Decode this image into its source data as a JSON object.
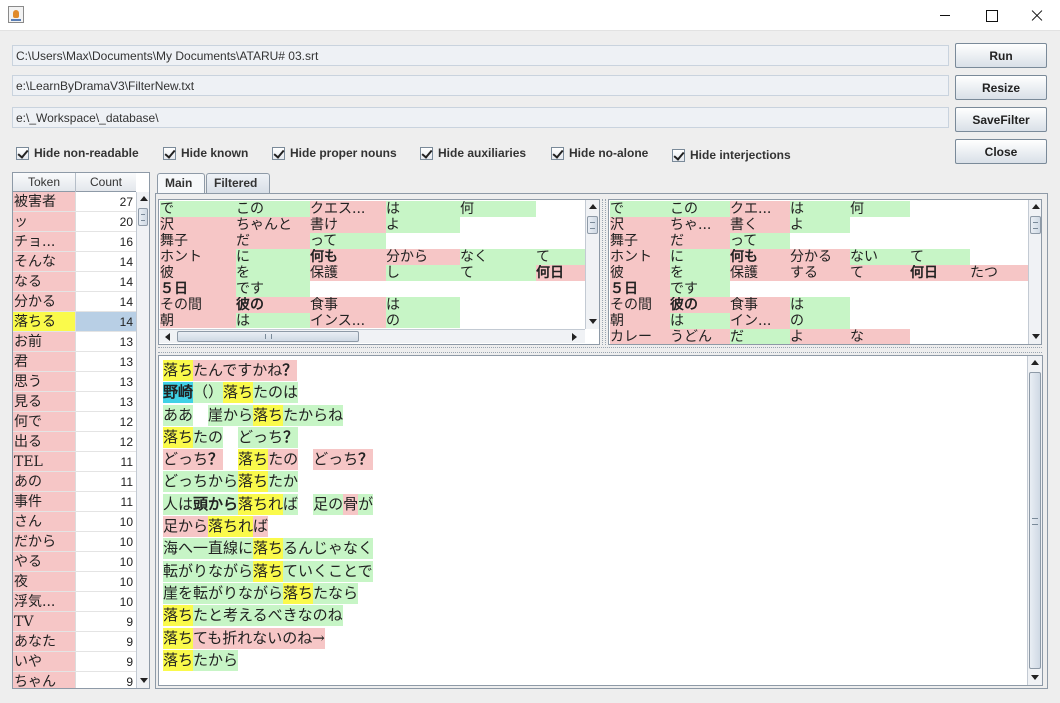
{
  "window": {
    "icon": "java-cup-icon",
    "controls": [
      "minimize-icon",
      "maximize-icon",
      "close-icon"
    ]
  },
  "paths": {
    "subtitle_file": "C:\\Users\\Max\\Documents\\My Documents\\ATARU# 03.srt",
    "filter_file": "e:\\LearnByDramaV3\\FilterNew.txt",
    "database_dir": "e:\\_Workspace\\_database\\"
  },
  "buttons": {
    "run": "Run",
    "resize": "Resize",
    "save_filter": "SaveFilter",
    "close": "Close"
  },
  "filters": [
    {
      "label": "Hide non-readable",
      "checked": true
    },
    {
      "label": "Hide known",
      "checked": true
    },
    {
      "label": "Hide proper nouns",
      "checked": true
    },
    {
      "label": "Hide auxiliaries",
      "checked": true
    },
    {
      "label": "Hide no-alone",
      "checked": true
    },
    {
      "label": "Hide interjections",
      "checked": true
    }
  ],
  "token_table": {
    "headers": [
      "Token",
      "Count"
    ],
    "selected_index": 6,
    "rows": [
      {
        "token": "被害者",
        "count": "27"
      },
      {
        "token": "ッ",
        "count": "20"
      },
      {
        "token": "チョ...",
        "count": "16"
      },
      {
        "token": "そんな",
        "count": "14"
      },
      {
        "token": "なる",
        "count": "14"
      },
      {
        "token": "分かる",
        "count": "14"
      },
      {
        "token": "落ちる",
        "count": "14"
      },
      {
        "token": "お前",
        "count": "13"
      },
      {
        "token": "君",
        "count": "13"
      },
      {
        "token": "思う",
        "count": "13"
      },
      {
        "token": "見る",
        "count": "13"
      },
      {
        "token": "何で",
        "count": "12"
      },
      {
        "token": "出る",
        "count": "12"
      },
      {
        "token": "TEL",
        "count": "11"
      },
      {
        "token": "あの",
        "count": "11"
      },
      {
        "token": "事件",
        "count": "11"
      },
      {
        "token": "さん",
        "count": "10"
      },
      {
        "token": "だから",
        "count": "10"
      },
      {
        "token": "やる",
        "count": "10"
      },
      {
        "token": "夜",
        "count": "10"
      },
      {
        "token": "浮気...",
        "count": "10"
      },
      {
        "token": "TV",
        "count": "9"
      },
      {
        "token": "あなた",
        "count": "9"
      },
      {
        "token": "いや",
        "count": "9"
      },
      {
        "token": "ちゃん",
        "count": "9"
      }
    ]
  },
  "tabs": {
    "main": "Main",
    "filtered": "Filtered",
    "active": "main"
  },
  "colors": {
    "known": "#f6c6c6",
    "green": "#c7f5c6",
    "highlight": "#fafa4b",
    "name": "#3fd1e6",
    "selection": "#b8cfe5"
  },
  "grid_left": [
    [
      {
        "t": "で",
        "c": "g"
      },
      {
        "t": "この",
        "c": "g"
      },
      {
        "t": "クエス...",
        "c": "k"
      },
      {
        "t": "は",
        "c": "g"
      },
      {
        "t": "何",
        "c": "g"
      },
      {
        "t": "",
        "c": "e"
      }
    ],
    [
      {
        "t": "沢",
        "c": "k"
      },
      {
        "t": "ちゃんと",
        "c": "k"
      },
      {
        "t": "書け",
        "c": "k"
      },
      {
        "t": "よ",
        "c": "g"
      },
      {
        "t": "",
        "c": "e"
      },
      {
        "t": "",
        "c": "e"
      }
    ],
    [
      {
        "t": "舞子",
        "c": "k"
      },
      {
        "t": "だ",
        "c": "k"
      },
      {
        "t": "って",
        "c": "g"
      },
      {
        "t": "",
        "c": "e"
      },
      {
        "t": "",
        "c": "e"
      },
      {
        "t": "",
        "c": "e"
      }
    ],
    [
      {
        "t": "ホント",
        "c": "k"
      },
      {
        "t": "に",
        "c": "g"
      },
      {
        "t": "何も",
        "c": "k",
        "b": true
      },
      {
        "t": "分から",
        "c": "k"
      },
      {
        "t": "なく",
        "c": "g"
      },
      {
        "t": "て",
        "c": "g"
      }
    ],
    [
      {
        "t": "彼",
        "c": "k"
      },
      {
        "t": "を",
        "c": "g"
      },
      {
        "t": "保護",
        "c": "k"
      },
      {
        "t": "し",
        "c": "g"
      },
      {
        "t": "て",
        "c": "g"
      },
      {
        "t": "何日",
        "c": "k",
        "b": true
      }
    ],
    [
      {
        "t": "５日",
        "c": "k",
        "b": true
      },
      {
        "t": "です",
        "c": "g"
      },
      {
        "t": "",
        "c": "e"
      },
      {
        "t": "",
        "c": "e"
      },
      {
        "t": "",
        "c": "e"
      },
      {
        "t": "",
        "c": "e"
      }
    ],
    [
      {
        "t": "その間",
        "c": "k"
      },
      {
        "t": "彼の",
        "c": "k",
        "b": true
      },
      {
        "t": "食事",
        "c": "k"
      },
      {
        "t": "は",
        "c": "g"
      },
      {
        "t": "",
        "c": "e"
      },
      {
        "t": "",
        "c": "e"
      }
    ],
    [
      {
        "t": "朝",
        "c": "k"
      },
      {
        "t": "は",
        "c": "g"
      },
      {
        "t": "インス...",
        "c": "k"
      },
      {
        "t": "の",
        "c": "g"
      },
      {
        "t": "",
        "c": "e"
      },
      {
        "t": "",
        "c": "e"
      }
    ]
  ],
  "grid_right": [
    [
      {
        "t": "で",
        "c": "g"
      },
      {
        "t": "この",
        "c": "g"
      },
      {
        "t": "クエ...",
        "c": "k"
      },
      {
        "t": "は",
        "c": "g"
      },
      {
        "t": "何",
        "c": "g"
      },
      {
        "t": "",
        "c": "e"
      },
      {
        "t": "",
        "c": "e"
      }
    ],
    [
      {
        "t": "沢",
        "c": "k"
      },
      {
        "t": "ちゃ...",
        "c": "k"
      },
      {
        "t": "書く",
        "c": "k"
      },
      {
        "t": "よ",
        "c": "g"
      },
      {
        "t": "",
        "c": "e"
      },
      {
        "t": "",
        "c": "e"
      },
      {
        "t": "",
        "c": "e"
      }
    ],
    [
      {
        "t": "舞子",
        "c": "k"
      },
      {
        "t": "だ",
        "c": "k"
      },
      {
        "t": "って",
        "c": "g"
      },
      {
        "t": "",
        "c": "e"
      },
      {
        "t": "",
        "c": "e"
      },
      {
        "t": "",
        "c": "e"
      },
      {
        "t": "",
        "c": "e"
      }
    ],
    [
      {
        "t": "ホント",
        "c": "k"
      },
      {
        "t": "に",
        "c": "g"
      },
      {
        "t": "何も",
        "c": "k",
        "b": true
      },
      {
        "t": "分かる",
        "c": "k"
      },
      {
        "t": "ない",
        "c": "g"
      },
      {
        "t": "て",
        "c": "g"
      },
      {
        "t": "",
        "c": "e"
      }
    ],
    [
      {
        "t": "彼",
        "c": "k"
      },
      {
        "t": "を",
        "c": "g"
      },
      {
        "t": "保護",
        "c": "k"
      },
      {
        "t": "する",
        "c": "k"
      },
      {
        "t": "て",
        "c": "k"
      },
      {
        "t": "何日",
        "c": "k",
        "b": true
      },
      {
        "t": "たつ",
        "c": "k"
      }
    ],
    [
      {
        "t": "５日",
        "c": "k",
        "b": true
      },
      {
        "t": "です",
        "c": "g"
      },
      {
        "t": "",
        "c": "e"
      },
      {
        "t": "",
        "c": "e"
      },
      {
        "t": "",
        "c": "e"
      },
      {
        "t": "",
        "c": "e"
      },
      {
        "t": "",
        "c": "e"
      }
    ],
    [
      {
        "t": "その間",
        "c": "k"
      },
      {
        "t": "彼の",
        "c": "k",
        "b": true
      },
      {
        "t": "食事",
        "c": "k"
      },
      {
        "t": "は",
        "c": "g"
      },
      {
        "t": "",
        "c": "e"
      },
      {
        "t": "",
        "c": "e"
      },
      {
        "t": "",
        "c": "e"
      }
    ],
    [
      {
        "t": "朝",
        "c": "k"
      },
      {
        "t": "は",
        "c": "g"
      },
      {
        "t": "イン...",
        "c": "k"
      },
      {
        "t": "の",
        "c": "g"
      },
      {
        "t": "",
        "c": "e"
      },
      {
        "t": "",
        "c": "e"
      },
      {
        "t": "",
        "c": "e"
      }
    ],
    [
      {
        "t": "カレー",
        "c": "k"
      },
      {
        "t": "うどん",
        "c": "k"
      },
      {
        "t": "だ",
        "c": "g"
      },
      {
        "t": "よ",
        "c": "k"
      },
      {
        "t": "な",
        "c": "k"
      },
      {
        "t": "",
        "c": "e"
      },
      {
        "t": "",
        "c": "e"
      }
    ]
  ],
  "sentences": [
    [
      {
        "t": "落ち",
        "c": "y"
      },
      {
        "t": "たんですかね",
        "c": "k"
      },
      {
        "t": "？",
        "c": "k",
        "b": true
      }
    ],
    [
      {
        "t": "野崎",
        "c": "c",
        "b": true
      },
      {
        "t": "（）",
        "c": "g"
      },
      {
        "t": "落ち",
        "c": "y"
      },
      {
        "t": "たのは",
        "c": "g"
      }
    ],
    [
      {
        "t": "ああ",
        "c": "g"
      },
      {
        "t": "　",
        "c": "n"
      },
      {
        "t": "崖から",
        "c": "g"
      },
      {
        "t": "落ち",
        "c": "y"
      },
      {
        "t": "たからね",
        "c": "g"
      }
    ],
    [
      {
        "t": "落ち",
        "c": "y"
      },
      {
        "t": "たの",
        "c": "g"
      },
      {
        "t": "　",
        "c": "n"
      },
      {
        "t": "どっち",
        "c": "g"
      },
      {
        "t": "？",
        "c": "g",
        "b": true
      }
    ],
    [
      {
        "t": "どっち",
        "c": "k"
      },
      {
        "t": "？",
        "c": "k",
        "b": true
      },
      {
        "t": "　",
        "c": "n"
      },
      {
        "t": "落ち",
        "c": "y"
      },
      {
        "t": "たの",
        "c": "k"
      },
      {
        "t": "　",
        "c": "n"
      },
      {
        "t": "どっち",
        "c": "k"
      },
      {
        "t": "？",
        "c": "k",
        "b": true
      }
    ],
    [
      {
        "t": "どっちから",
        "c": "g"
      },
      {
        "t": "落ち",
        "c": "y"
      },
      {
        "t": "たか",
        "c": "g"
      }
    ],
    [
      {
        "t": "人は",
        "c": "g"
      },
      {
        "t": "頭から",
        "c": "g",
        "b": true
      },
      {
        "t": "落ちれ",
        "c": "y"
      },
      {
        "t": "ば",
        "c": "g"
      },
      {
        "t": "　",
        "c": "n"
      },
      {
        "t": "足の",
        "c": "g"
      },
      {
        "t": "骨",
        "c": "k"
      },
      {
        "t": "が",
        "c": "g"
      }
    ],
    [
      {
        "t": "足から",
        "c": "k"
      },
      {
        "t": "落ちれ",
        "c": "y"
      },
      {
        "t": "ば",
        "c": "k"
      }
    ],
    [
      {
        "t": "海へ一直線に",
        "c": "g"
      },
      {
        "t": "落ち",
        "c": "y"
      },
      {
        "t": "るんじゃなく",
        "c": "g"
      }
    ],
    [
      {
        "t": "転がりながら",
        "c": "g"
      },
      {
        "t": "落ち",
        "c": "y"
      },
      {
        "t": "ていくことで",
        "c": "g"
      }
    ],
    [
      {
        "t": "崖を転がりながら",
        "c": "g"
      },
      {
        "t": "落ち",
        "c": "y"
      },
      {
        "t": "たなら",
        "c": "g"
      }
    ],
    [
      {
        "t": "落ち",
        "c": "y"
      },
      {
        "t": "たと考えるべきなのね",
        "c": "g"
      }
    ],
    [
      {
        "t": "落ち",
        "c": "y"
      },
      {
        "t": "ても折れないのね→",
        "c": "k"
      }
    ],
    [
      {
        "t": "落ち",
        "c": "y"
      },
      {
        "t": "たから",
        "c": "g"
      }
    ]
  ]
}
